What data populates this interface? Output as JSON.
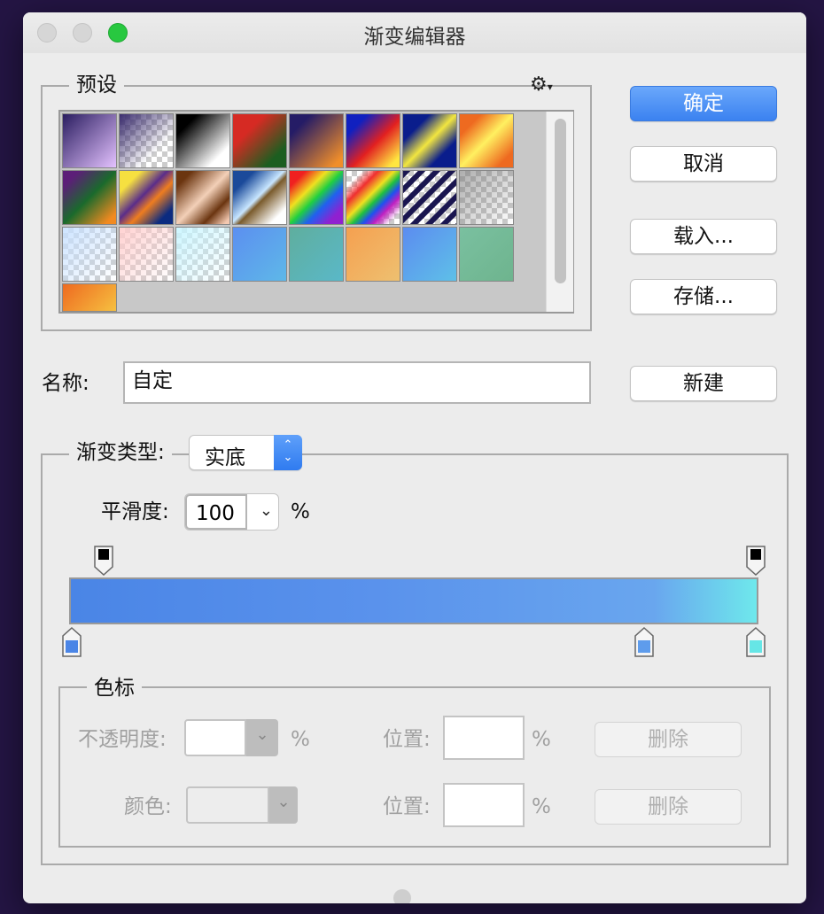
{
  "window": {
    "title": "渐变编辑器",
    "buttons": {
      "close": "close",
      "minimize": "minimize",
      "maximize": "maximize"
    }
  },
  "presets": {
    "legend": "预设",
    "gear_icon": "⚙",
    "swatches": [
      {
        "name": "purple-to-pink",
        "bg": "linear-gradient(135deg,#2a1d60,#e4c2ff)"
      },
      {
        "name": "purple-to-transparent",
        "bg": "linear-gradient(135deg,#3a2c6e 0%,rgba(58,44,110,0) 70%)",
        "checker": true
      },
      {
        "name": "black-to-white",
        "bg": "linear-gradient(135deg,#000 20%,#fff 80%)"
      },
      {
        "name": "red-to-green",
        "bg": "linear-gradient(135deg,#d62a23 30%,#1c5e20 80%)"
      },
      {
        "name": "violet-to-orange",
        "bg": "linear-gradient(135deg,#251c66 20%,#f08e2a 90%)"
      },
      {
        "name": "blue-red-yellow",
        "bg": "linear-gradient(135deg,#1020c0 20%,#e22020 55%,#ffe640 90%)"
      },
      {
        "name": "blue-yellow-blue",
        "bg": "linear-gradient(135deg,#0a1d8c 25%,#f2e640 50%,#0a1d8c 75%)"
      },
      {
        "name": "orange-yellow-orange",
        "bg": "linear-gradient(135deg,#ee6a20 20%,#fff060 50%,#ee6a20 85%)"
      },
      {
        "name": "violet-green-orange",
        "bg": "linear-gradient(135deg,#5c1e78 15%,#1a6a2c 50%,#f28a20 90%)"
      },
      {
        "name": "yellow-violet-orange-blue",
        "bg": "linear-gradient(135deg,#f6e040 20%,#5a2d8a 45%,#ee7d20 60%,#0b2b80 85%)"
      },
      {
        "name": "copper",
        "bg": "linear-gradient(135deg,#6b3510 15%,#f3d0b8 50%,#6b3510 75%,#f3c8b0 95%)"
      },
      {
        "name": "chrome",
        "bg": "linear-gradient(135deg,#1b4a9a 20%,#c8e6ff 48%,#7a5b2c 55%,#fff 85%)"
      },
      {
        "name": "spectrum",
        "bg": "linear-gradient(135deg,#f02020 15%,#f0e020 35%,#20d040 50%,#2060f0 65%,#9020d0 85%)"
      },
      {
        "name": "transparent-rainbow",
        "bg": "linear-gradient(135deg,rgba(255,0,0,0) 15%,#f03030 30%,#f0e020 45%,#20c040 55%,#2050f0 65%,#c020c0 75%,rgba(255,0,255,0) 90%)",
        "checker": true
      },
      {
        "name": "transparent-stripes",
        "bg": "repeating-linear-gradient(135deg,#1a1650 0 6px,transparent 6px 12px)",
        "checker": true
      },
      {
        "name": "neutral-density",
        "bg": "linear-gradient(135deg,rgba(120,120,120,0.6),rgba(255,255,255,0))",
        "checker": true
      },
      {
        "name": "light-blue-transparent",
        "bg": "linear-gradient(135deg,rgba(200,225,255,0.9),rgba(255,255,255,0))",
        "checker": true
      },
      {
        "name": "light-pink-transparent",
        "bg": "linear-gradient(135deg,rgba(255,205,205,0.9),rgba(255,255,255,0))",
        "checker": true
      },
      {
        "name": "light-cyan-transparent",
        "bg": "linear-gradient(135deg,rgba(200,245,255,0.9),rgba(255,255,255,0))",
        "checker": true
      },
      {
        "name": "blue",
        "bg": "linear-gradient(135deg,#5c8ff0,#5eb8e8)"
      },
      {
        "name": "teal",
        "bg": "linear-gradient(135deg,#5fae9e,#5ab8c8)"
      },
      {
        "name": "orange",
        "bg": "linear-gradient(135deg,#f5a050,#eec070)"
      },
      {
        "name": "sky",
        "bg": "linear-gradient(135deg,#5c8cf0,#5ec0e8)"
      },
      {
        "name": "sage",
        "bg": "linear-gradient(135deg,#7ac0a0,#6eb48e)"
      },
      {
        "name": "orange-yellow",
        "bg": "linear-gradient(135deg,#ee6a20,#f6c040)"
      }
    ]
  },
  "buttons": {
    "ok": "确定",
    "cancel": "取消",
    "load": "载入...",
    "save": "存储...",
    "new": "新建"
  },
  "name_field": {
    "label": "名称:",
    "value": "自定"
  },
  "gradient_type": {
    "label": "渐变类型:",
    "value": "实底",
    "arrows": "⌃⌄"
  },
  "smoothness": {
    "label": "平滑度:",
    "value": "100",
    "unit": "%"
  },
  "gradient": {
    "colors": [
      "#4a85e6",
      "#5a92ec",
      "#69a6ee",
      "#6ee8ec"
    ]
  },
  "stops": {
    "legend": "色标",
    "opacity_label": "不透明度:",
    "opacity_unit": "%",
    "opacity_position_label": "位置:",
    "opacity_position_unit": "%",
    "opacity_delete": "删除",
    "color_label": "颜色:",
    "color_position_label": "位置:",
    "color_position_unit": "%",
    "color_delete": "删除",
    "color_stop_colors": [
      "#4a85e6",
      "#5e9cec",
      "#66e6e6"
    ]
  }
}
